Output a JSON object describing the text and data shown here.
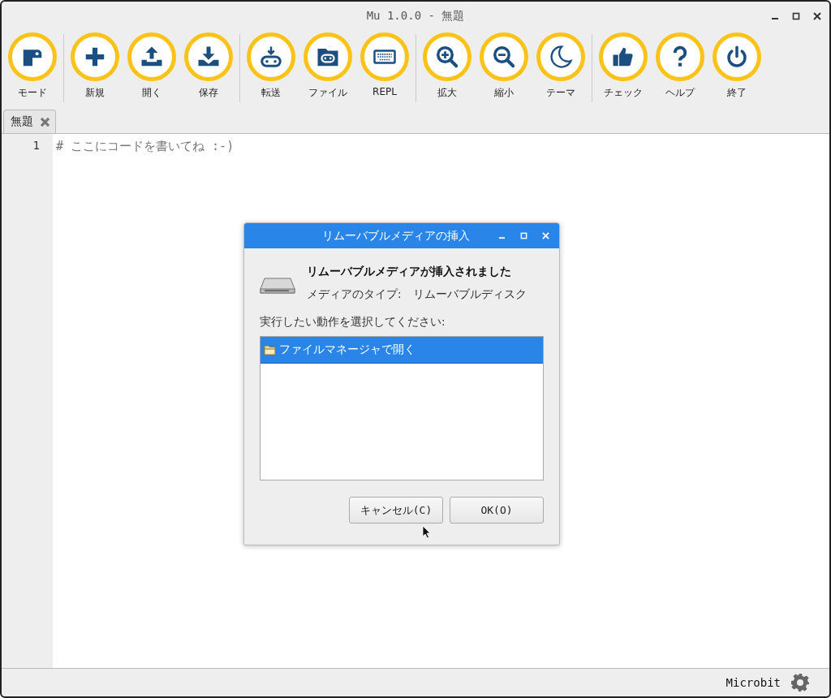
{
  "window": {
    "title": "Mu 1.0.0 - 無題"
  },
  "toolbar_groups": [
    [
      {
        "label": "モード"
      }
    ],
    [
      {
        "label": "新規"
      },
      {
        "label": "開く"
      },
      {
        "label": "保存"
      }
    ],
    [
      {
        "label": "転送"
      },
      {
        "label": "ファイル"
      },
      {
        "label": "REPL"
      }
    ],
    [
      {
        "label": "拡大"
      },
      {
        "label": "縮小"
      },
      {
        "label": "テーマ"
      }
    ],
    [
      {
        "label": "チェック"
      },
      {
        "label": "ヘルプ"
      },
      {
        "label": "終了"
      }
    ]
  ],
  "tabs": [
    {
      "label": "無題",
      "selected": true
    }
  ],
  "editor": {
    "lines": [
      {
        "number": "1",
        "text": "# ここにコードを書いてね :-)"
      }
    ]
  },
  "status_bar": {
    "mode": "Microbit"
  },
  "dialog": {
    "title": "リムーバブルメディアの挿入",
    "heading": "リムーバブルメディアが挿入されました",
    "media_type_label": "メディアのタイプ:",
    "media_type": "リムーバブルディスク",
    "prompt": "実行したい動作を選択してください:",
    "actions": [
      {
        "label": "ファイルマネージャで開く",
        "selected": true
      }
    ],
    "buttons": [
      "キャンセル(C)",
      "OK(O)"
    ]
  }
}
